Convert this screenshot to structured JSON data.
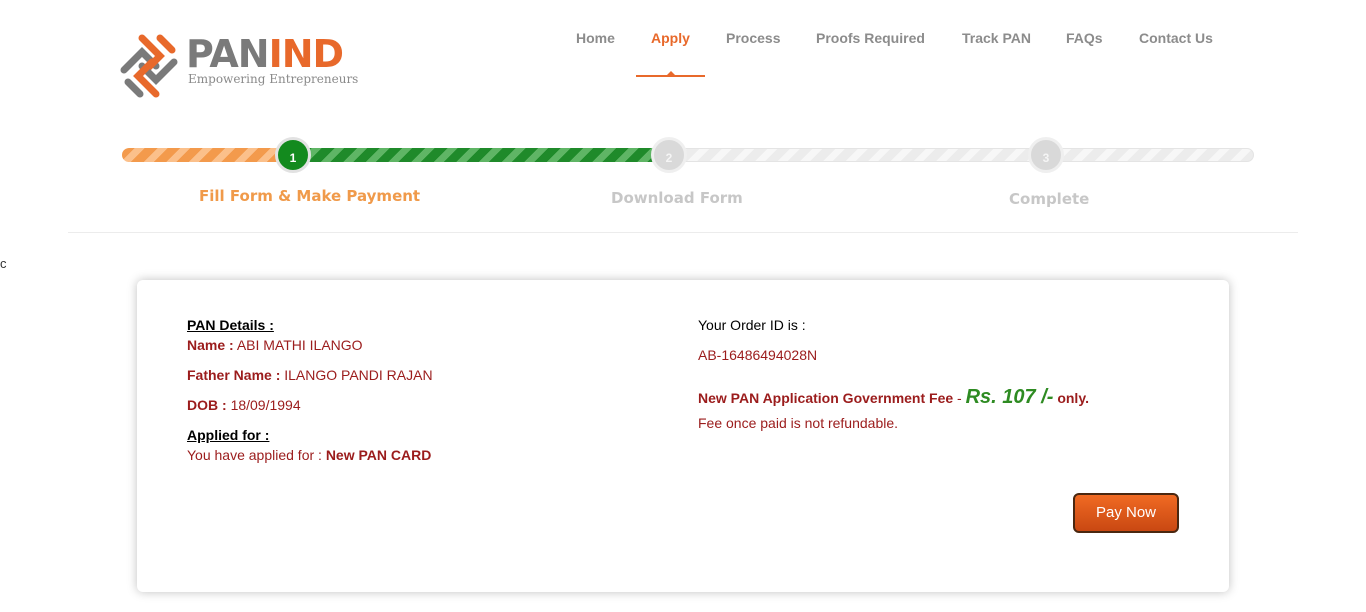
{
  "brand": {
    "name_part1": "PAN",
    "name_part2": "IND",
    "tagline": "Empowering Entrepreneurs"
  },
  "nav": {
    "items": [
      {
        "label": "Home"
      },
      {
        "label": "Apply"
      },
      {
        "label": "Process"
      },
      {
        "label": "Proofs Required"
      },
      {
        "label": "Track PAN"
      },
      {
        "label": "FAQs"
      },
      {
        "label": "Contact Us"
      }
    ],
    "active": "Apply"
  },
  "steps": [
    {
      "number": "1",
      "label": "Fill Form & Make Payment",
      "status": "active"
    },
    {
      "number": "2",
      "label": "Download Form",
      "status": "pending"
    },
    {
      "number": "3",
      "label": "Complete",
      "status": "pending"
    }
  ],
  "stray_text": "c",
  "details": {
    "pan_heading": "PAN Details :",
    "name_label": "Name :",
    "name_value": "ABI MATHI ILANGO",
    "father_label": "Father Name :",
    "father_value": "ILANGO PANDI RAJAN",
    "dob_label": "DOB :",
    "dob_value": "18/09/1994",
    "applied_heading": "Applied for :",
    "applied_text": "You have applied for :",
    "applied_value": "New PAN CARD"
  },
  "order": {
    "label": "Your Order ID is :",
    "id": "AB-16486494028N",
    "fee_text": "New PAN Application Government Fee",
    "fee_sep": " - ",
    "fee_amount": "Rs. 107 /-",
    "fee_suffix": " only.",
    "refund_note": "Fee once paid is not refundable."
  },
  "actions": {
    "pay_label": "Pay Now"
  },
  "colors": {
    "accent": "#e8692b",
    "step_done": "#138a1e",
    "text_red": "#9b1c1c",
    "fee_green": "#2e8b22"
  }
}
